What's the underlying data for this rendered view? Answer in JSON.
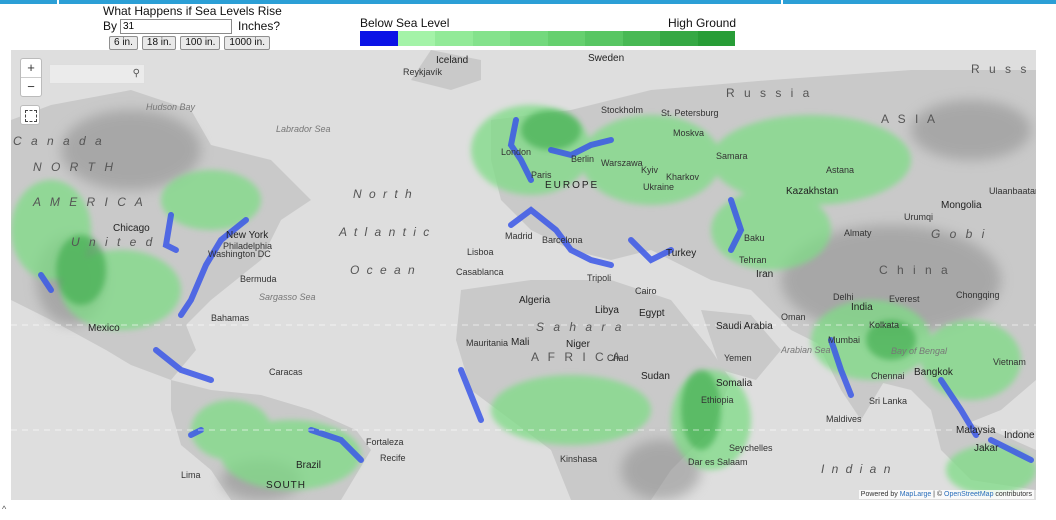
{
  "panel": {
    "title": "What Happens if Sea Levels Rise",
    "by_label": "By",
    "inches_value": "31",
    "inches_label": "Inches?",
    "presets": [
      "6 in.",
      "18 in.",
      "100 in.",
      "1000 in."
    ]
  },
  "legend": {
    "low_label": "Below Sea Level",
    "high_label": "High Ground",
    "colors": [
      "#0b13e6",
      "#a4f3a8",
      "#92ea98",
      "#84e28c",
      "#73d97d",
      "#66d06f",
      "#58c663",
      "#48b954",
      "#35a844",
      "#289d37"
    ]
  },
  "map": {
    "zoom_in": "+",
    "zoom_out": "−",
    "search_icon": "⚲",
    "attribution_prefix": "Powered by",
    "attribution_brand": "MapLarge",
    "attribution_sep": " | © ",
    "attribution_osm": "OpenStreetMap",
    "attribution_suffix": " contributors",
    "labels": {
      "north_america_1": "N O R T H",
      "north_america_2": "A M E R I C A",
      "canada": "C a n a d a",
      "united_states": "U n i t e d",
      "north_atlantic_1": "N o r t h",
      "north_atlantic_2": "A t l a n t i c",
      "north_atlantic_3": "O c e a n",
      "africa": "A F R I C A",
      "sahara": "S a h a r a",
      "europe": "EUROPE",
      "russia_1": "R u s s",
      "russia_2": "R u s s i a",
      "asia": "A S I A",
      "china": "C h i n a",
      "gobi": "G o b i",
      "indian_ocean": "I n d i a n",
      "south_america": "SOUTH",
      "mongolia": "Mongolia",
      "kazakhstan": "Kazakhstan",
      "india": "India",
      "algeria": "Algeria",
      "libya": "Libya",
      "egypt": "Egypt",
      "mali": "Mali",
      "niger": "Niger",
      "saudi_arabia": "Saudi Arabia",
      "iran": "Iran",
      "turkey": "Turkey",
      "ukraine": "Ukraine",
      "iceland": "Iceland",
      "sweden": "Sweden",
      "new_york": "New York",
      "chicago": "Chicago",
      "mexico": "Mexico",
      "brazil": "Brazil",
      "ethiopia": "Ethiopia",
      "somalia": "Somalia",
      "madrid": "Madrid",
      "london": "London",
      "moskva": "Moskva",
      "bahamas": "Bahamas",
      "bermuda": "Bermuda",
      "reykjavik": "Reykjavík",
      "mumbai": "Mumbai",
      "chennai": "Chennai",
      "bangkok": "Bangkok",
      "labrador_sea": "Labrador Sea",
      "hudson_bay": "Hudson Bay",
      "sargasso": "Sargasso Sea",
      "arabian_sea": "Arabian Sea",
      "bay_of_bengal": "Bay of Bengal",
      "philadelphia": "Philadelphia",
      "washington": "Washington DC",
      "caracas": "Caracas",
      "lima": "Lima",
      "yemen": "Yemen",
      "sudan": "Sudan",
      "chad": "Chad",
      "tripoli": "Tripoli",
      "cairo": "Cairo",
      "oman": "Oman",
      "kolkata": "Kolkata",
      "mauritania": "Mauritania",
      "casablanca": "Casablanca",
      "lisboa": "Lisboa",
      "barcelona": "Barcelona",
      "kinshasa": "Kinshasa",
      "dar_es_salaam": "Dar es Salaam",
      "seychelles": "Seychelles",
      "fortaleza": "Fortaleza",
      "recife": "Recife",
      "malaysia": "Malaysia",
      "indonesia": "Indone",
      "jakarta": "Jakar",
      "sri_lanka": "Sri Lanka",
      "maldives": "Maldives",
      "vietnam": "Vietnam",
      "chongqing": "Chongqing",
      "everest": "Everest",
      "delhi": "Delhi",
      "tehran": "Tehran",
      "baku": "Baku",
      "almaty": "Almaty",
      "urumqi": "Urumqi",
      "ulaanbaatar": "Ulaanbaatar",
      "astana": "Astana",
      "samara": "Samara",
      "kharkov": "Kharkov",
      "kyiv": "Kyiv",
      "warszawa": "Warszawa",
      "berlin": "Berlin",
      "paris": "Paris",
      "stockholm": "Stockholm",
      "st_petersburg": "St. Petersburg"
    }
  }
}
